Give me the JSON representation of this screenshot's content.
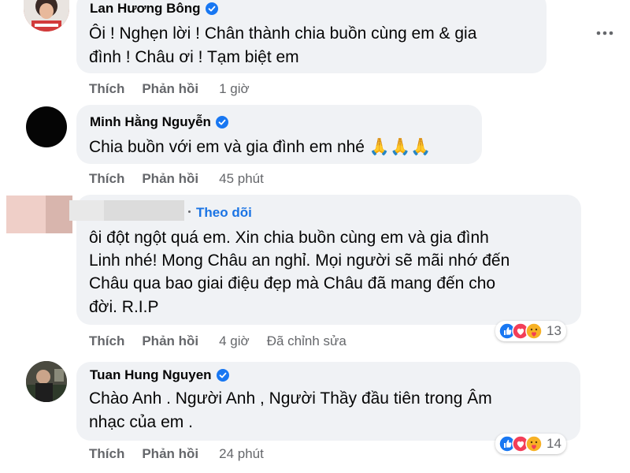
{
  "comments": [
    {
      "author": "Lan Hương Bông",
      "verified": true,
      "lines": [
        "Ôi ! Nghẹn lời ! Chân thành chia buồn cùng em & gia",
        "đình ! Châu ơi ! Tạm biệt em"
      ],
      "like_label": "Thích",
      "reply_label": "Phản hồi",
      "time": "1 giờ"
    },
    {
      "author": "Minh Hằng Nguyễn",
      "verified": true,
      "lines": [
        "Chia buồn với em và gia đình em nhé 🙏🙏🙏"
      ],
      "like_label": "Thích",
      "reply_label": "Phản hồi",
      "time": "45 phút"
    },
    {
      "author": "",
      "follow_label": "Theo dõi",
      "lines": [
        "ôi đột ngột quá em. Xin chia buồn cùng em và gia đình",
        "Linh nhé! Mong Châu an nghỉ. Mọi người sẽ mãi nhớ đến",
        "Châu qua bao giai điệu đẹp mà Châu đã mang đến cho",
        "đời. R.I.P"
      ],
      "like_label": "Thích",
      "reply_label": "Phản hồi",
      "time": "4 giờ",
      "edited_label": "Đã chỉnh sửa",
      "reaction_count": "13",
      "reaction_icons": [
        "like-icon",
        "love-icon",
        "care-icon"
      ]
    },
    {
      "author": "Tuan Hung Nguyen",
      "verified": true,
      "lines": [
        "Chào Anh . Người Anh , Người Thầy đầu tiên trong Âm",
        "nhạc của em ."
      ],
      "like_label": "Thích",
      "reply_label": "Phản hồi",
      "time": "24 phút",
      "reaction_count": "14",
      "reaction_icons": [
        "like-icon",
        "love-icon",
        "care-icon"
      ]
    }
  ],
  "colors": {
    "bubble": "#f0f2f5",
    "link_blue": "#1b74e4",
    "meta_gray": "#65676b",
    "verified_blue": "#1877f2"
  }
}
